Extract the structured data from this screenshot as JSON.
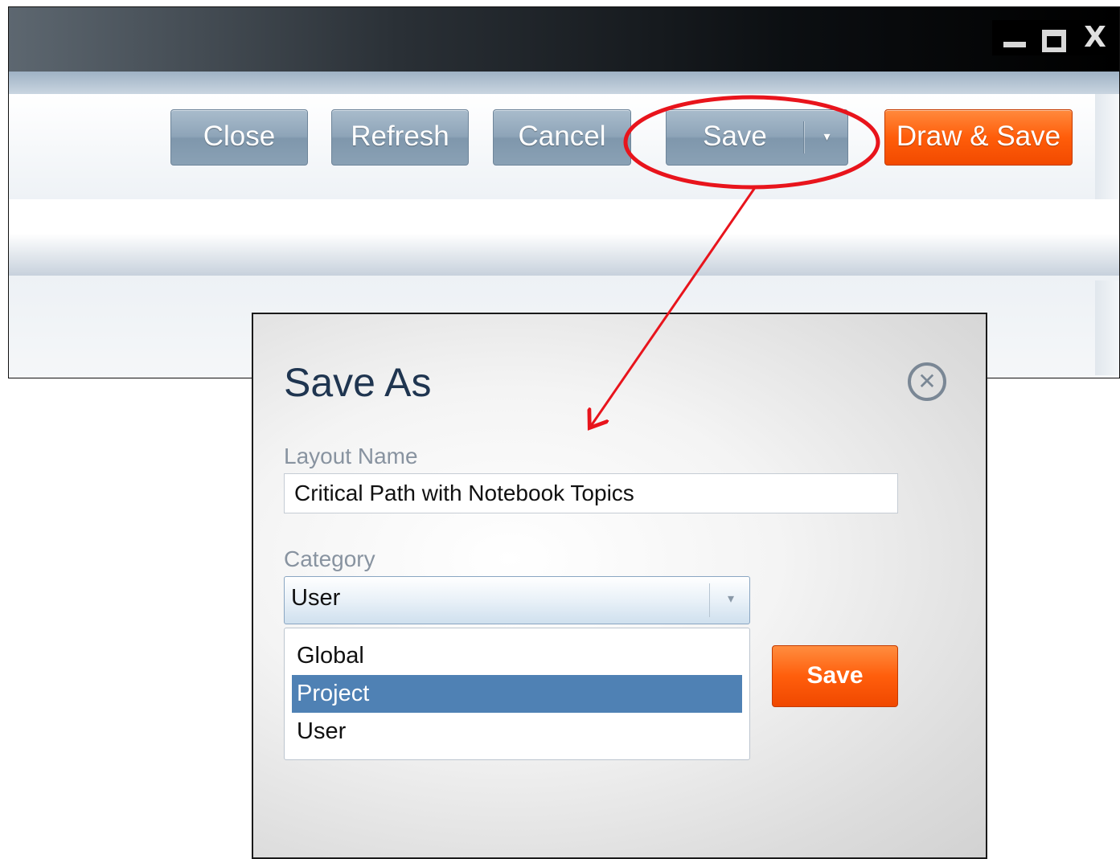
{
  "window": {
    "controls": {
      "minimize": "minimize-icon",
      "maximize": "maximize-icon",
      "close": "X"
    }
  },
  "toolbar": {
    "close_label": "Close",
    "refresh_label": "Refresh",
    "cancel_label": "Cancel",
    "save_label": "Save",
    "save_dropdown_glyph": "▾",
    "draw_save_label": "Draw & Save"
  },
  "dialog": {
    "title": "Save As",
    "close_glyph": "✕",
    "layout_name_label": "Layout Name",
    "layout_name_value": "Critical Path with Notebook Topics",
    "category_label": "Category",
    "category_selected": "User",
    "category_chevron": "▾",
    "category_options": [
      "Global",
      "Project",
      "User"
    ],
    "highlighted_option": "Project",
    "save_label": "Save"
  },
  "colors": {
    "accent_orange": "#ff5e0c",
    "button_blue_gray": "#8ea4b8",
    "selection_blue": "#4f81b4",
    "annotation_red": "#e8141c",
    "title_navy": "#1f3550"
  }
}
